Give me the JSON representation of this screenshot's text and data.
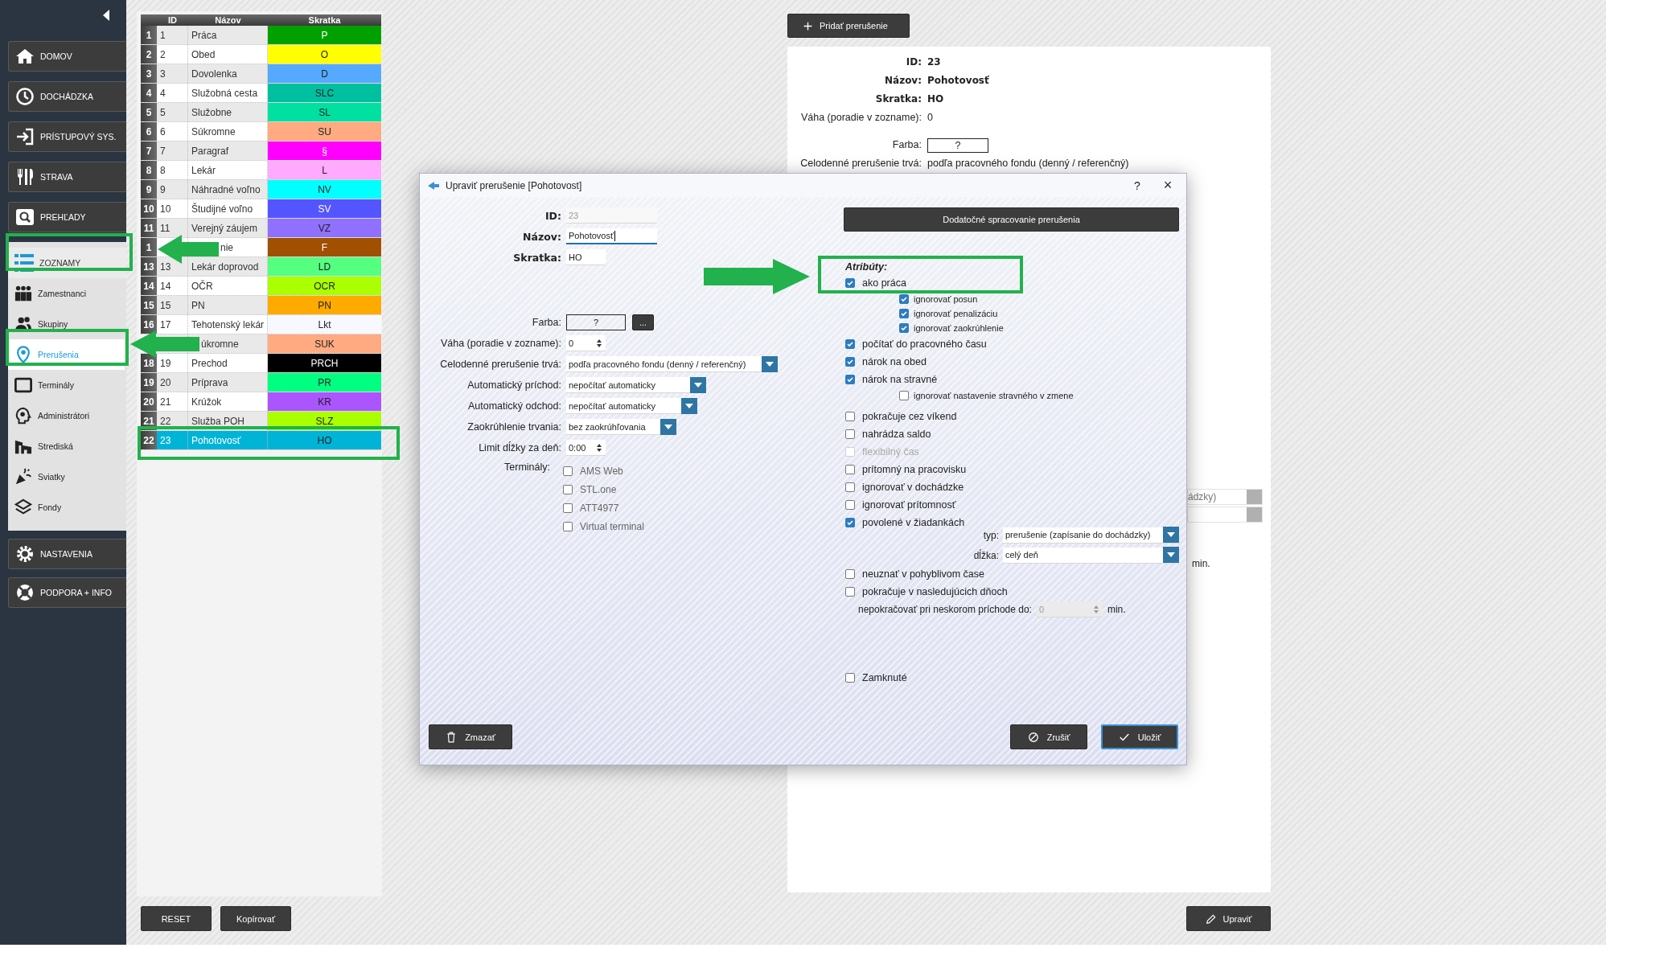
{
  "sidebar": {
    "nav_top": [
      {
        "label": "DOMOV"
      },
      {
        "label": "DOCHÁDZKA"
      },
      {
        "label": "PRÍSTUPOVÝ SYS."
      },
      {
        "label": "STRAVA"
      },
      {
        "label": "PREHĽADY"
      }
    ],
    "submenu": {
      "label": "ZOZNAMY",
      "items": [
        {
          "label": "Zamestnanci",
          "selected": false
        },
        {
          "label": "Skupiny",
          "selected": false
        },
        {
          "label": "Prerušenia",
          "selected": true
        },
        {
          "label": "Terminály",
          "selected": false
        },
        {
          "label": "Administrátori",
          "selected": false
        },
        {
          "label": "Strediská",
          "selected": false
        },
        {
          "label": "Sviatky",
          "selected": false
        },
        {
          "label": "Fondy",
          "selected": false
        }
      ]
    },
    "nav_bottom": [
      {
        "label": "NASTAVENIA"
      },
      {
        "label": "PODPORA + INFO"
      }
    ]
  },
  "table": {
    "columns": [
      "ID",
      "Názov",
      "Skratka"
    ],
    "rows": [
      {
        "num": "1",
        "id": "1",
        "name": "Práca",
        "code": "P",
        "color": "#00a000",
        "selected": false
      },
      {
        "num": "2",
        "id": "2",
        "name": "Obed",
        "code": "O",
        "color": "#ffff00",
        "selected": false
      },
      {
        "num": "3",
        "id": "3",
        "name": "Dovolenka",
        "code": "D",
        "color": "#55aaff",
        "selected": false
      },
      {
        "num": "4",
        "id": "4",
        "name": "Služobná cesta",
        "code": "SLC",
        "color": "#00c0a0",
        "selected": false
      },
      {
        "num": "5",
        "id": "5",
        "name": "Služobne",
        "code": "SL",
        "color": "#00e0a0",
        "selected": false
      },
      {
        "num": "6",
        "id": "6",
        "name": "Súkromne",
        "code": "SU",
        "color": "#ffaa80",
        "selected": false
      },
      {
        "num": "7",
        "id": "7",
        "name": "Paragraf",
        "code": "§",
        "color": "#ff00ff",
        "selected": false
      },
      {
        "num": "8",
        "id": "8",
        "name": "Lekár",
        "code": "L",
        "color": "#ffaaff",
        "selected": false
      },
      {
        "num": "9",
        "id": "9",
        "name": "Náhradné voľno",
        "code": "NV",
        "color": "#00ffff",
        "selected": false
      },
      {
        "num": "10",
        "id": "10",
        "name": "Študijné voľno",
        "code": "SV",
        "color": "#5555ff",
        "selected": false
      },
      {
        "num": "11",
        "id": "11",
        "name": "Verejný záujem",
        "code": "VZ",
        "color": "#9070ff",
        "selected": false
      },
      {
        "num": "1",
        "name": "nie",
        "code": "F",
        "color": "#a05000",
        "selected": false
      },
      {
        "num": "13",
        "id": "13",
        "name": "Lekár doprovod",
        "code": "LD",
        "color": "#55ff80",
        "selected": false
      },
      {
        "num": "14",
        "id": "14",
        "name": "OČR",
        "code": "OCR",
        "color": "#aaff00",
        "selected": false
      },
      {
        "num": "15",
        "id": "15",
        "name": "PN",
        "code": "PN",
        "color": "#ffaa00",
        "selected": false
      },
      {
        "num": "16",
        "id": "17",
        "name": "Tehotenský lekár",
        "code": "Lkt",
        "color": "#f8f8ff",
        "selected": false
      },
      {
        "name": "úkromne",
        "code": "SUK",
        "color": "#ffaa80",
        "selected": false
      },
      {
        "num": "18",
        "id": "19",
        "name": "Prechod",
        "code": "PRCH",
        "color": "#000000",
        "selected": false
      },
      {
        "num": "19",
        "id": "20",
        "name": "Príprava",
        "code": "PR",
        "color": "#00ff80",
        "selected": false
      },
      {
        "num": "20",
        "id": "21",
        "name": "Krúžok",
        "code": "KR",
        "color": "#aa55ff",
        "selected": false
      },
      {
        "num": "21",
        "id": "22",
        "name": "Služba POH",
        "code": "SLZ",
        "color": "#aaff00",
        "selected": false
      },
      {
        "num": "22",
        "id": "23",
        "name": "Pohotovosť",
        "code": "HO",
        "color": "#00b4d8",
        "selected": true
      }
    ]
  },
  "left_buttons": [
    "RESET",
    "Kopírovať"
  ],
  "add_button": "Pridať prerušenie",
  "details": {
    "rows": [
      {
        "label": "ID:",
        "value": "23",
        "bold": true
      },
      {
        "label": "Názov:",
        "value": "Pohotovosť",
        "bold": true
      },
      {
        "label": "Skratka:",
        "value": "HO",
        "bold": true
      },
      {
        "label": "Váha (poradie v zozname):",
        "value": "0",
        "bold": false
      }
    ],
    "color": {
      "label": "Farba:",
      "value": "?"
    },
    "full_day": {
      "label": "Celodenné prerušenie trvá:",
      "value": "podľa pracovného fondu (denný / referenčný)"
    },
    "peek_select": "ádzky)",
    "peek_unit": "min."
  },
  "edit_button": "Upraviť",
  "dialog": {
    "title": "Upraviť prerušenie [Pohotovost]",
    "help": "?",
    "close": "×",
    "fields": [
      {
        "kind": "text",
        "label": "ID:",
        "value": "23",
        "bold": true,
        "disabled": true,
        "focused": false
      },
      {
        "kind": "text",
        "label": "Názov:",
        "value": "Pohotovosť",
        "bold": true,
        "disabled": false,
        "focused": true
      },
      {
        "kind": "text",
        "label": "Skratka:",
        "value": "HO",
        "bold": true,
        "disabled": false,
        "focused": false
      },
      {
        "kind": "color",
        "label": "Farba:",
        "value": "?",
        "button": "..."
      },
      {
        "kind": "spin",
        "label": "Váha (poradie v zozname):",
        "value": "0"
      },
      {
        "kind": "select",
        "label": "Celodenné prerušenie trvá:",
        "value": "podľa pracovného fondu (denný / referenčný)"
      },
      {
        "kind": "select",
        "label": "Automatický príchod:",
        "value": "nepočítať automaticky"
      },
      {
        "kind": "select",
        "label": "Automatický odchod:",
        "value": "nepočítať automaticky"
      },
      {
        "kind": "select",
        "label": "Zaokrúhlenie trvania:",
        "value": "bez zaokrúhľovania"
      },
      {
        "kind": "spin",
        "label": "Limit dĺžky za deň:",
        "value": "0:00"
      },
      {
        "kind": "checks",
        "label": "Terminály:",
        "options": [
          {
            "label": "AMS Web",
            "checked": false
          },
          {
            "label": "STL.one",
            "checked": false
          },
          {
            "label": "ATT4977",
            "checked": false
          },
          {
            "label": "Virtual terminal",
            "checked": false
          }
        ]
      }
    ],
    "extra_button": "Dodatočné spracovanie prerušenia",
    "attributes_heading": "Atribúty:",
    "groups": [
      [
        {
          "label": "ako práca",
          "checked": true,
          "disabled": false,
          "children": [
            {
              "label": "ignorovať posun",
              "checked": true,
              "disabled": false
            },
            {
              "label": "ignorovať penalizáciu",
              "checked": true,
              "disabled": false
            },
            {
              "label": "ignorovať zaokrúhlenie",
              "checked": true,
              "disabled": false
            }
          ]
        },
        {
          "label": "počítať do pracovného času",
          "checked": true,
          "disabled": false
        },
        {
          "label": "nárok na obed",
          "checked": true,
          "disabled": false
        },
        {
          "label": "nárok na stravné",
          "checked": true,
          "disabled": false,
          "children": [
            {
              "label": "ignorovať nastavenie stravného v zmene",
              "checked": false,
              "disabled": false
            }
          ]
        }
      ],
      [
        {
          "label": "pokračuje cez víkend",
          "checked": false,
          "disabled": false
        },
        {
          "label": "nahrádza saldo",
          "checked": false,
          "disabled": false
        },
        {
          "label": "flexibilný čas",
          "checked": false,
          "disabled": true
        },
        {
          "label": "prítomný na pracovisku",
          "checked": false,
          "disabled": false
        },
        {
          "label": "ignorovať v dochádzke",
          "checked": false,
          "disabled": false
        },
        {
          "label": "ignorovať prítomnosť",
          "checked": false,
          "disabled": false
        },
        {
          "label": "povolené v žiadankách",
          "checked": true,
          "disabled": false,
          "fields": [
            {
              "label": "typ:",
              "value": "prerušenie (zapísanie do dochádzky)"
            },
            {
              "label": "dĺžka:",
              "value": "celý deň"
            }
          ]
        },
        {
          "label": "neuznať v pohyblivom čase",
          "checked": false,
          "disabled": false
        },
        {
          "label": "pokračuje v nasledujúcich dňoch",
          "checked": false,
          "disabled": false,
          "spin": {
            "label": "nepokračovať pri neskorom príchode do:",
            "value": "0",
            "unit": "min.",
            "disabled": true
          }
        }
      ]
    ],
    "locked": {
      "label": "Zamknuté",
      "checked": false,
      "disabled": false
    },
    "buttons": [
      {
        "label": "Zmazať",
        "kind": "delete"
      },
      {
        "label": "Zrušiť",
        "kind": "cancel"
      },
      {
        "label": "Uložiť",
        "kind": "save"
      }
    ]
  }
}
